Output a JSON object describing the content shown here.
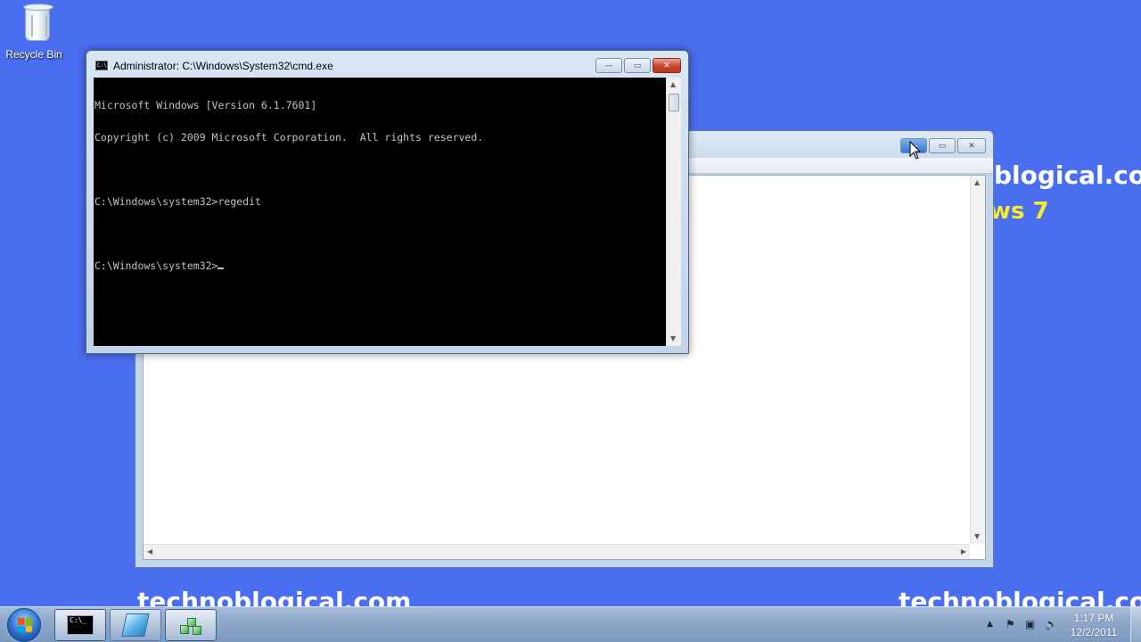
{
  "desktop": {
    "background_color": "#4a6ef0",
    "icons": [
      {
        "label": "Recycle Bin",
        "icon": "recycle-bin-icon"
      }
    ],
    "wallpaper_text": {
      "top_right_url": "blogical.co",
      "top_right_subtitle": "ws 7",
      "bottom_left_url": "technoblogical.com",
      "bottom_right_url": "technoblogical.co"
    }
  },
  "cmd_window": {
    "title": "Administrator: C:\\Windows\\System32\\cmd.exe",
    "app_icon_text": "C:\\.",
    "buttons": {
      "minimize": "—",
      "maximize": "▭",
      "close": "✕"
    },
    "console_lines": [
      "Microsoft Windows [Version 6.1.7601]",
      "Copyright (c) 2009 Microsoft Corporation.  All rights reserved.",
      "",
      "C:\\Windows\\system32>regedit",
      "",
      "C:\\Windows\\system32>"
    ],
    "scroll_up": "▲",
    "scroll_down": "▼"
  },
  "background_window": {
    "buttons": {
      "minimize": "—",
      "maximize": "▭",
      "close": "✕"
    },
    "scroll_up": "▲",
    "scroll_down": "▼",
    "scroll_left": "◀",
    "scroll_right": "▶"
  },
  "taskbar": {
    "start_icon": "windows-start-orb",
    "buttons": [
      {
        "app": "cmd",
        "icon": "command-prompt-icon",
        "icon_text": "C:\\_"
      },
      {
        "app": "ie",
        "icon": "internet-explorer-icon"
      },
      {
        "app": "regedit",
        "icon": "registry-editor-icon"
      }
    ],
    "tray": {
      "show_hidden": "▲",
      "flag": "⚑",
      "network": "▣",
      "volume": "🔈"
    },
    "clock": {
      "time": "1:17 PM",
      "date": "12/2/2011"
    }
  }
}
